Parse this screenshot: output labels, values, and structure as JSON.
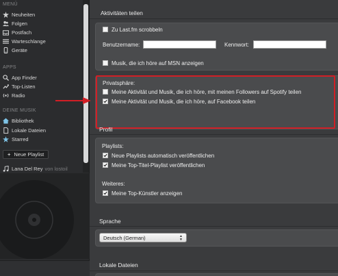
{
  "sidebar": {
    "sections": [
      {
        "heading": "MENÜ",
        "items": [
          {
            "label": "Neuheiten",
            "icon": "star-burst-icon"
          },
          {
            "label": "Folgen",
            "icon": "people-icon"
          },
          {
            "label": "Postfach",
            "icon": "inbox-icon"
          },
          {
            "label": "Warteschlange",
            "icon": "queue-list-icon"
          },
          {
            "label": "Geräte",
            "icon": "device-icon"
          }
        ]
      },
      {
        "heading": "APPS",
        "items": [
          {
            "label": "App Finder",
            "icon": "app-finder-icon"
          },
          {
            "label": "Top-Listen",
            "icon": "top-lists-icon"
          },
          {
            "label": "Radio",
            "icon": "radio-icon"
          }
        ]
      },
      {
        "heading": "DEINE MUSIK",
        "items": [
          {
            "label": "Bibliothek",
            "icon": "house-icon"
          },
          {
            "label": "Lokale Dateien",
            "icon": "file-icon"
          },
          {
            "label": "Starred",
            "icon": "star-icon"
          }
        ]
      }
    ],
    "new_playlist_label": "Neue Playlist",
    "now_playing": {
      "artist": "Lana Del Rey",
      "user": "von lostoil"
    }
  },
  "main": {
    "activities": {
      "heading": "Aktivitäten teilen",
      "lastfm_label": "Zu Last.fm scrobbeln",
      "lastfm_checked": false,
      "username_label": "Benutzername:",
      "username_value": "",
      "password_label": "Kennwort:",
      "password_value": "",
      "msn_label": "Musik, die ich höre auf MSN anzeigen",
      "msn_checked": false
    },
    "privacy": {
      "heading": "Privatsphäre:",
      "spotify_label": "Meine Aktivität und Musik, die ich höre, mit meinen Followers auf Spotify teilen",
      "spotify_checked": false,
      "facebook_label": "Meine Aktivität und Musik, die ich höre, auf Facebook teilen",
      "facebook_checked": true
    },
    "profile": {
      "heading": "Profil",
      "playlists_label": "Playlists:",
      "auto_publish_label": "Neue Playlists automatisch veröffentlichen",
      "auto_publish_checked": true,
      "top_tracks_label": "Meine Top-Titel-Playlist veröffentlichen",
      "top_tracks_checked": true,
      "more_label": "Weiteres:",
      "top_artists_label": "Meine Top-Künstler anzeigen",
      "top_artists_checked": true
    },
    "language": {
      "heading": "Sprache",
      "selected": "Deutsch (German)"
    },
    "local_files": {
      "heading": "Lokale Dateien"
    }
  },
  "colors": {
    "highlight_box": "#d21e25",
    "annotation_arrow": "#d21e25",
    "sidebar_bg": "#2b2c2e",
    "main_bg": "#3a3b3d",
    "panel_bg": "#4a4b4d"
  }
}
